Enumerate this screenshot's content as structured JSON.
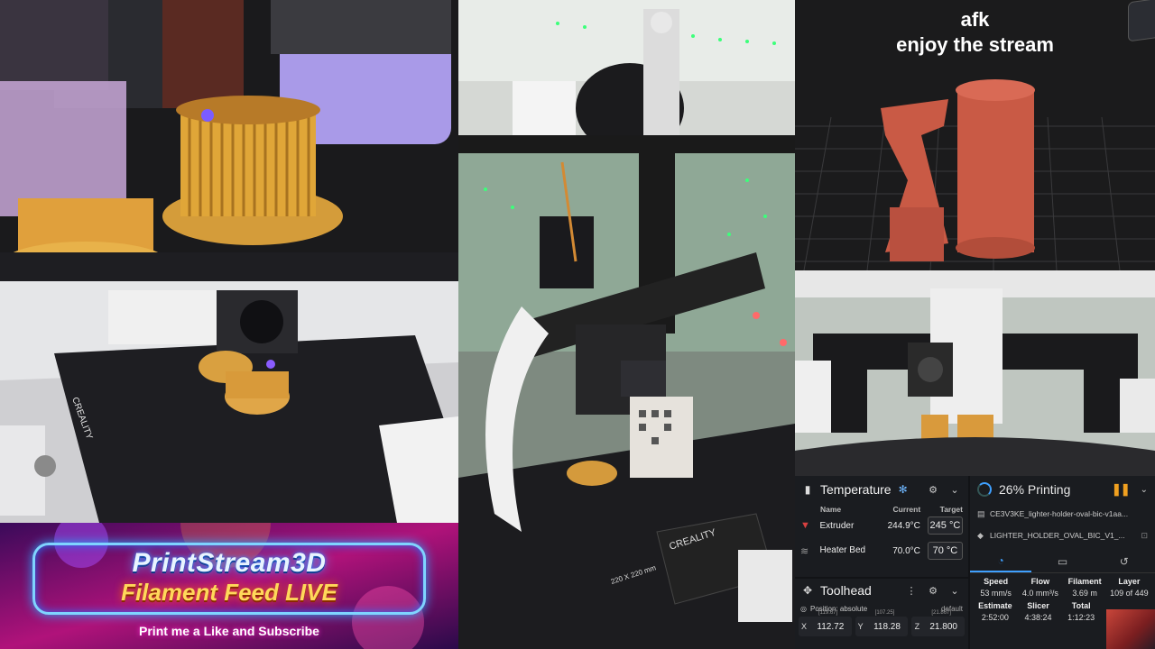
{
  "overlay": {
    "line1": "afk",
    "line2": "enjoy the stream"
  },
  "banner": {
    "title": "PrintStream3D",
    "subtitle": "Filament Feed LIVE",
    "tagline": "Print me a Like and Subscribe"
  },
  "camera_labels": {
    "bed_brand": "CREALITY",
    "bed_size": "220 X 220 mm",
    "nozzle_brand": "CREALITY"
  },
  "temperature": {
    "title": "Temperature",
    "columns": [
      "Name",
      "Current",
      "Target"
    ],
    "rows": [
      {
        "name": "Extruder",
        "current": "244.9°C",
        "target": "245 °C"
      },
      {
        "name": "Heater Bed",
        "current": "70.0°C",
        "target": "70 °C"
      }
    ]
  },
  "toolhead": {
    "title": "Toolhead",
    "position_label": "Position: absolute",
    "profile": "default",
    "axes": [
      {
        "label": "X",
        "value": "112.72",
        "bracket": "[119.67]"
      },
      {
        "label": "Y",
        "value": "118.28",
        "bracket": "[107.25]"
      },
      {
        "label": "Z",
        "value": "21.800",
        "bracket": "[21.867]"
      }
    ]
  },
  "print": {
    "status": "26% Printing",
    "progress_percent": 26,
    "file_gcode": "CE3V3KE_lighter-holder-oval-bic-v1aa...",
    "file_object": "LIGHTER_HOLDER_OVAL_BIC_V1_...",
    "stats_row1": [
      {
        "label": "Speed",
        "value": "53 mm/s"
      },
      {
        "label": "Flow",
        "value": "4.0 mm³/s"
      },
      {
        "label": "Filament",
        "value": "3.69 m"
      },
      {
        "label": "Layer",
        "value": "109 of 449"
      }
    ],
    "stats_row2": [
      {
        "label": "Estimate",
        "value": "2:52:00"
      },
      {
        "label": "Slicer",
        "value": "4:38:24"
      },
      {
        "label": "Total",
        "value": "1:12:23"
      }
    ]
  },
  "colors": {
    "accent": "#3fa0ff",
    "pause": "#f0a020",
    "preview_model": "#c95a45"
  }
}
